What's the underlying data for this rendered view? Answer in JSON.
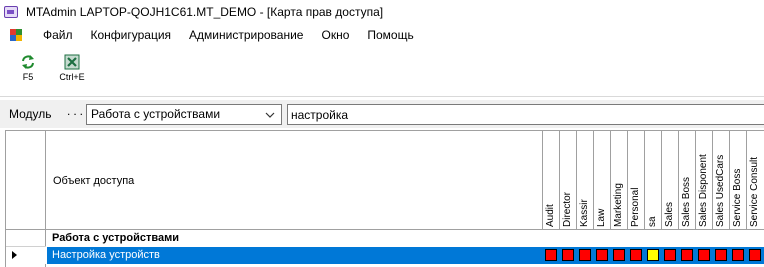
{
  "window": {
    "title": "MTAdmin LAPTOP-QOJH1C61.MT_DEMO - [Карта прав доступа]"
  },
  "menu": {
    "items": [
      "Файл",
      "Конфигурация",
      "Администрирование",
      "Окно",
      "Помощь"
    ]
  },
  "toolbar": {
    "refresh_label": "F5",
    "refresh_icon": "refresh-icon",
    "excel_label": "Ctrl+E",
    "excel_icon": "excel-icon"
  },
  "filter": {
    "module_label": "Модуль",
    "dots": "...",
    "module_value": "Работа с устройствами",
    "search_value": "настройка"
  },
  "grid": {
    "object_header": "Объект доступа",
    "roles": [
      "Audit",
      "Director",
      "Kassir",
      "Law",
      "Marketing",
      "Personal",
      "sa",
      "Sales",
      "Sales Boss",
      "Sales Disponent",
      "Sales UsedCars",
      "Service Boss",
      "Service Consult"
    ],
    "group_label": "Работа с устройствами",
    "row_label": "Настройка устройств",
    "row_states": [
      "denied",
      "denied",
      "denied",
      "denied",
      "denied",
      "denied",
      "granted",
      "denied",
      "denied",
      "denied",
      "denied",
      "denied",
      "denied"
    ]
  },
  "colors": {
    "denied": "#ff0000",
    "granted": "#ffff00",
    "selection": "#0078d7"
  }
}
